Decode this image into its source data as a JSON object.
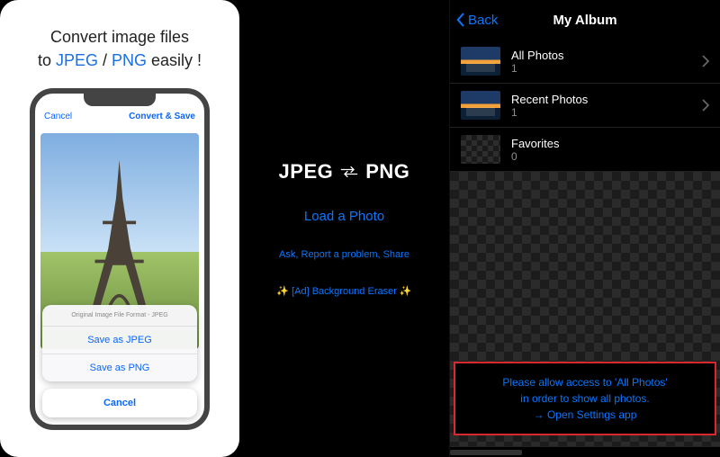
{
  "panel1": {
    "headline_pre": "Convert image files",
    "headline_to": "to ",
    "headline_jpeg": "JPEG",
    "headline_sep": " / ",
    "headline_png": "PNG",
    "headline_post": " easily !",
    "nav_cancel": "Cancel",
    "nav_action": "Convert & Save",
    "sheet_header": "Original Image File Format - JPEG",
    "sheet_jpeg": "Save as JPEG",
    "sheet_png": "Save as PNG",
    "sheet_cancel": "Cancel"
  },
  "panel2": {
    "title_left": "JPEG",
    "title_right": "PNG",
    "load": "Load a Photo",
    "sub": "Ask, Report a problem, Share",
    "ad": "✨ [Ad] Background Eraser ✨"
  },
  "panel3": {
    "back": "Back",
    "title": "My Album",
    "albums": [
      {
        "name": "All Photos",
        "count": "1"
      },
      {
        "name": "Recent Photos",
        "count": "1"
      },
      {
        "name": "Favorites",
        "count": "0"
      }
    ],
    "notice_l1": "Please allow access to 'All Photos'",
    "notice_l2": "in order to show all photos.",
    "notice_l3": "→ Open Settings app"
  }
}
